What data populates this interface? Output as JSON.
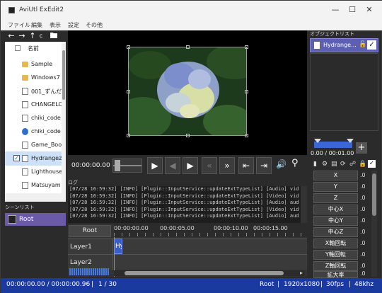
{
  "window": {
    "title": "AviUtl ExEdit2"
  },
  "menu": {
    "items": [
      "ファイル",
      "編集",
      "表示",
      "設定",
      "その他"
    ]
  },
  "explorer": {
    "header": "名前",
    "nav_c": "c",
    "items": [
      {
        "name": "Sample",
        "type": "folder",
        "checked": false
      },
      {
        "name": "Windows7",
        "type": "folder",
        "checked": false
      },
      {
        "name": "001_ずんだ",
        "type": "file",
        "checked": false
      },
      {
        "name": "CHANGELO",
        "type": "file",
        "checked": false
      },
      {
        "name": "chiki_code",
        "type": "file",
        "checked": false
      },
      {
        "name": "chiki_code",
        "type": "file",
        "checked": false
      },
      {
        "name": "Game_Boo",
        "type": "file",
        "checked": false
      },
      {
        "name": "Hydrangez",
        "type": "file",
        "checked": true
      },
      {
        "name": "Lighthouse",
        "type": "file",
        "checked": false
      },
      {
        "name": "Matsuyam",
        "type": "file",
        "checked": false
      }
    ]
  },
  "scene_list": {
    "header": "シーンリスト",
    "items": [
      "Root"
    ]
  },
  "transport": {
    "timecode": "00:00:00.00"
  },
  "log": {
    "header": "ログ",
    "lines": [
      "[07/28 16:59:32] [INFO] [Plugin::InputService::updateExtTypeList] [Audio] vid",
      "[07/28 16:59:32] [INFO] [Plugin::InputService::updateExtTypeList] [Video] vid",
      "[07/28 16:59:32] [INFO] [Plugin::InputService::updateExtTypeList] [Audio] aud",
      "[07/28 16:59:32] [INFO] [Plugin::InputService::updateExtTypeList] [Video] vid",
      "[07/28 16:59:32] [INFO] [Plugin::InputService::updateExtTypeList] [Audio] aud"
    ]
  },
  "timeline": {
    "root_label": "Root",
    "ruler": [
      "00:00:00.00",
      "00:00:05.00",
      "00:00:10.00",
      "00:00:15.00"
    ],
    "layers": [
      "Layer1",
      "Layer2"
    ],
    "clip_label": "Hy"
  },
  "object_list": {
    "header": "オブジェクトリスト",
    "items": [
      "Hydrange..."
    ]
  },
  "properties": {
    "time": "0.00 / 00:01.00",
    "items": [
      {
        "label": "X",
        "value": ".0"
      },
      {
        "label": "Y",
        "value": ".0"
      },
      {
        "label": "Z",
        "value": ".0"
      },
      {
        "label": "中心X",
        "value": ".0"
      },
      {
        "label": "中心Y",
        "value": ".0"
      },
      {
        "label": "中心Z",
        "value": ".0"
      },
      {
        "label": "X軸回転",
        "value": ".0"
      },
      {
        "label": "Y軸回転",
        "value": ".0"
      },
      {
        "label": "Z軸回転",
        "value": ".0"
      },
      {
        "label": "拡大率",
        "value": ".0"
      }
    ]
  },
  "status": {
    "time": "00:00:00.00 / 00:00:00.96",
    "frame": "1 / 30",
    "scene": "Root",
    "resolution": "1920x1080",
    "fps": "30fps",
    "audio": "48khz"
  }
}
